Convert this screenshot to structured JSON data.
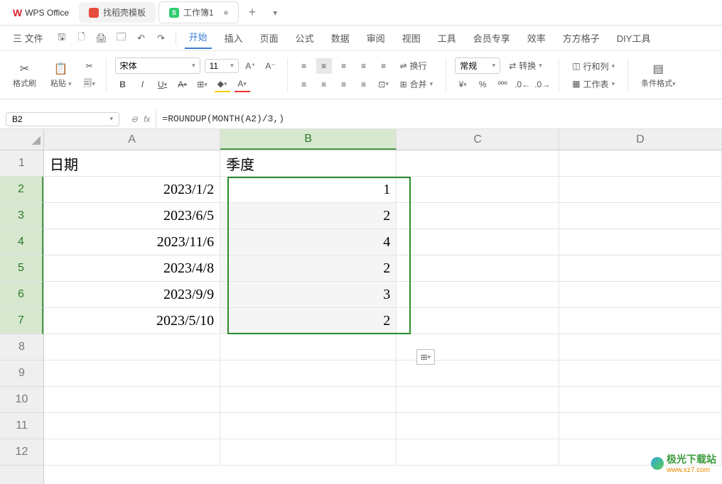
{
  "titlebar": {
    "app_name": "WPS Office",
    "tab_template": "找稻壳模板",
    "tab_workbook": "工作簿1",
    "add": "+"
  },
  "menubar": {
    "file": "三 文件",
    "items": [
      "开始",
      "插入",
      "页面",
      "公式",
      "数据",
      "审阅",
      "视图",
      "工具",
      "会员专享",
      "效率",
      "方方格子",
      "DIY工具"
    ]
  },
  "ribbon": {
    "format_painter": "格式刷",
    "paste": "粘贴",
    "font_name": "宋体",
    "font_size": "11",
    "wrap": "换行",
    "merge": "合并",
    "number_format": "常规",
    "convert": "转换",
    "rowcol": "行和列",
    "worksheet": "工作表",
    "cond_format": "条件格式"
  },
  "formula_bar": {
    "name_box": "B2",
    "formula": "=ROUNDUP(MONTH(A2)/3,)"
  },
  "columns": [
    "A",
    "B",
    "C",
    "D"
  ],
  "rows": [
    "1",
    "2",
    "3",
    "4",
    "5",
    "6",
    "7",
    "8",
    "9",
    "10",
    "11",
    "12"
  ],
  "data": {
    "header_a": "日期",
    "header_b": "季度",
    "r2a": "2023/1/2",
    "r2b": "1",
    "r3a": "2023/6/5",
    "r3b": "2",
    "r4a": "2023/11/6",
    "r4b": "4",
    "r5a": "2023/4/8",
    "r5b": "2",
    "r6a": "2023/9/9",
    "r6b": "3",
    "r7a": "2023/5/10",
    "r7b": "2"
  },
  "watermark": {
    "name": "极光下载站",
    "url": "www.xz7.com"
  }
}
